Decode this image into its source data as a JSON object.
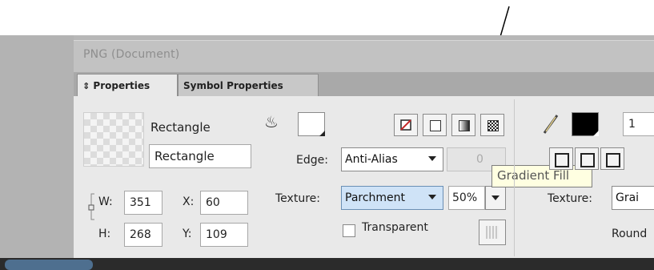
{
  "document": {
    "title": "PNG (Document)"
  },
  "tabs": [
    {
      "label": "Properties",
      "icon": "updown-arrows-icon"
    },
    {
      "label": "Symbol Properties"
    }
  ],
  "object": {
    "type_label": "Rectangle",
    "name_value": "Rectangle",
    "width_label": "W:",
    "width_value": "351",
    "height_label": "H:",
    "height_value": "268",
    "x_label": "X:",
    "x_value": "60",
    "y_label": "Y:",
    "y_value": "109"
  },
  "fill": {
    "edge_label": "Edge:",
    "edge_value": "Anti-Alias",
    "feather_value": "0",
    "texture_label": "Texture:",
    "texture_value": "Parchment",
    "texture_amount": "50%",
    "transparent_label": "Transparent",
    "fill_types": [
      "none",
      "solid",
      "gradient",
      "pattern"
    ]
  },
  "tooltip": {
    "text": "Gradient Fill"
  },
  "stroke": {
    "size_value": "1",
    "texture_label": "Texture:",
    "texture_value": "Grai",
    "round_label": "Round"
  },
  "colors": {
    "stroke_swatch": "#000000",
    "fill_swatch": "#ffffff",
    "select_highlight": "#cfe3f7"
  }
}
